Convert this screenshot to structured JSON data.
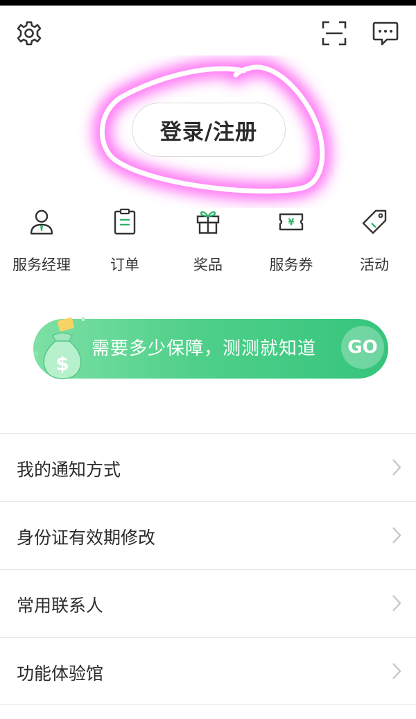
{
  "header": {
    "icons": [
      "gear-icon",
      "scan-icon",
      "message-icon"
    ]
  },
  "login": {
    "label": "登录/注册",
    "highlight_color": "#ff44ee"
  },
  "quick_links": [
    {
      "label": "服务经理",
      "icon": "manager-icon"
    },
    {
      "label": "订单",
      "icon": "clipboard-icon"
    },
    {
      "label": "奖品",
      "icon": "gift-icon"
    },
    {
      "label": "服务券",
      "icon": "coupon-icon"
    },
    {
      "label": "活动",
      "icon": "tag-icon"
    }
  ],
  "banner": {
    "text": "需要多少保障，测测就知道",
    "go_label": "GO",
    "accent_color": "#3dc87f"
  },
  "menu": [
    {
      "label": "我的通知方式"
    },
    {
      "label": "身份证有效期修改"
    },
    {
      "label": "常用联系人"
    },
    {
      "label": "功能体验馆"
    }
  ]
}
